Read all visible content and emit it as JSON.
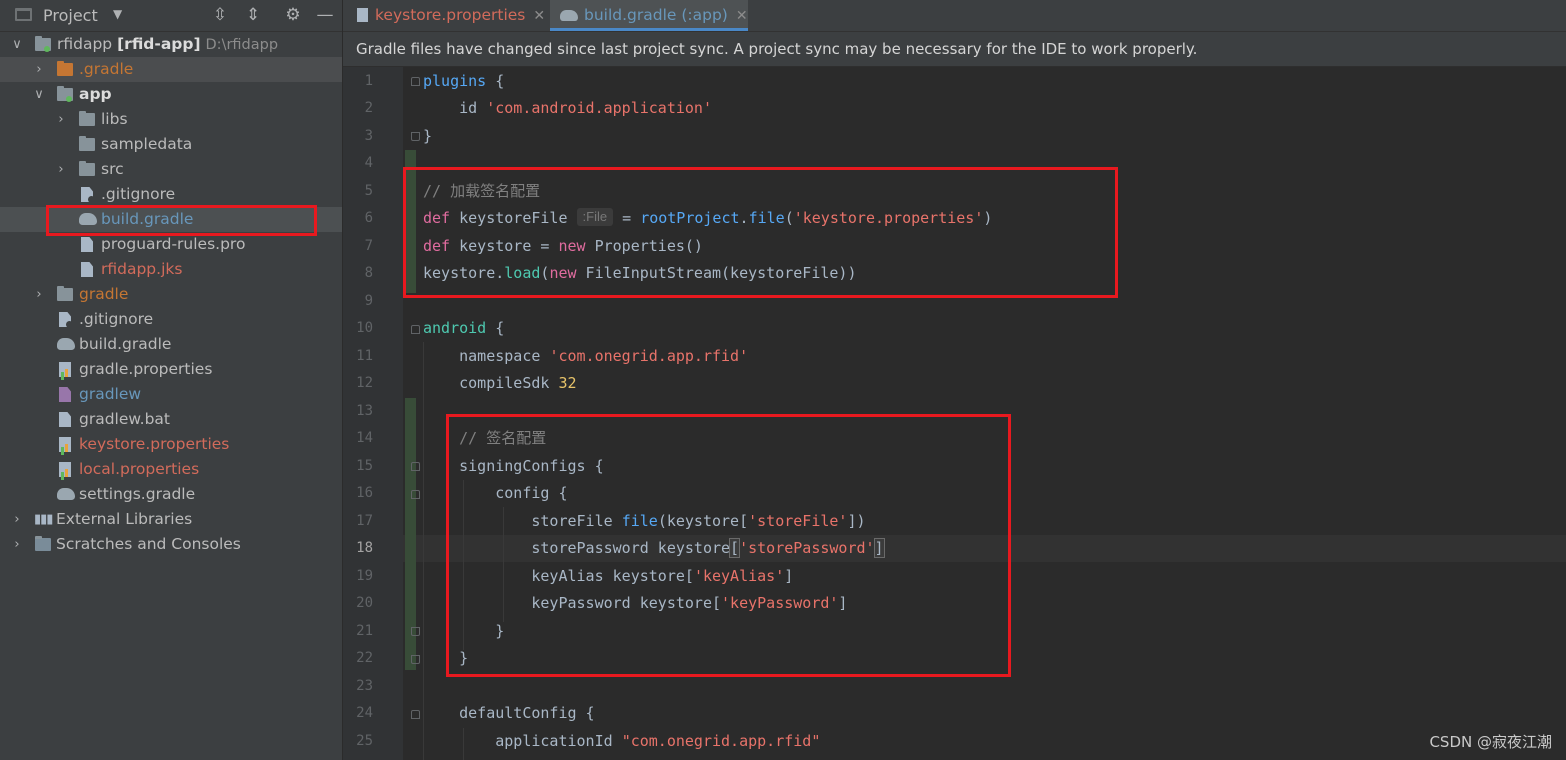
{
  "project_panel": {
    "title": "Project",
    "dropdown_glyph": "▼",
    "tree": [
      {
        "label": "rfidapp",
        "module": "[rfid-app]",
        "path": "D:\\rfidapp"
      },
      {
        "label": ".gradle"
      },
      {
        "label": "app"
      },
      {
        "label": "libs"
      },
      {
        "label": "sampledata"
      },
      {
        "label": "src"
      },
      {
        "label": ".gitignore"
      },
      {
        "label": "build.gradle"
      },
      {
        "label": "proguard-rules.pro"
      },
      {
        "label": "rfidapp.jks"
      },
      {
        "label": "gradle"
      },
      {
        "label": ".gitignore"
      },
      {
        "label": "build.gradle"
      },
      {
        "label": "gradle.properties"
      },
      {
        "label": "gradlew"
      },
      {
        "label": "gradlew.bat"
      },
      {
        "label": "keystore.properties"
      },
      {
        "label": "local.properties"
      },
      {
        "label": "settings.gradle"
      },
      {
        "label": "External Libraries"
      },
      {
        "label": "Scratches and Consoles"
      }
    ]
  },
  "tabs": [
    {
      "label": "keystore.properties",
      "close": "✕"
    },
    {
      "label": "build.gradle (:app)",
      "close": "✕"
    }
  ],
  "banner": "Gradle files have changed since last project sync. A project sync may be necessary for the IDE to work properly.",
  "line_numbers": [
    "1",
    "2",
    "3",
    "4",
    "5",
    "6",
    "7",
    "8",
    "9",
    "10",
    "11",
    "12",
    "13",
    "14",
    "15",
    "16",
    "17",
    "18",
    "19",
    "20",
    "21",
    "22",
    "23",
    "24",
    "25"
  ],
  "code": {
    "l1_a": "plugins",
    "l1_b": " {",
    "l2_a": "    id ",
    "l2_b": "'com.android.application'",
    "l3": "}",
    "l5": "// 加载签名配置",
    "l6_a": "def",
    "l6_b": " keystoreFile",
    "l6_hint": ":File",
    "l6_c": " = ",
    "l6_d": "rootProject",
    "l6_e": ".",
    "l6_f": "file",
    "l6_g": "(",
    "l6_h": "'keystore.properties'",
    "l6_i": ")",
    "l7_a": "def",
    "l7_b": " keystore = ",
    "l7_c": "new",
    "l7_d": " Properties()",
    "l8_a": "keystore.",
    "l8_b": "load",
    "l8_c": "(",
    "l8_d": "new",
    "l8_e": " FileInputStream(keystoreFile))",
    "l10_a": "android",
    "l10_b": " {",
    "l11_a": "    namespace ",
    "l11_b": "'com.onegrid.app.rfid'",
    "l12_a": "    compileSdk ",
    "l12_b": "32",
    "l14": "    // 签名配置",
    "l15": "    signingConfigs {",
    "l16": "        config {",
    "l17_a": "            storeFile ",
    "l17_b": "file",
    "l17_c": "(keystore[",
    "l17_d": "'storeFile'",
    "l17_e": "])",
    "l18_a": "            storePassword keystore",
    "l18_b": "[",
    "l18_c": "'storePassword'",
    "l18_d": "]",
    "l19_a": "            keyAlias keystore[",
    "l19_b": "'keyAlias'",
    "l19_c": "]",
    "l20_a": "            keyPassword keystore[",
    "l20_b": "'keyPassword'",
    "l20_c": "]",
    "l21": "        }",
    "l22": "    }",
    "l24": "    defaultConfig {",
    "l25_a": "        applicationId ",
    "l25_b": "\"com.onegrid.app.rfid\""
  },
  "watermark": "CSDN @寂夜江潮"
}
